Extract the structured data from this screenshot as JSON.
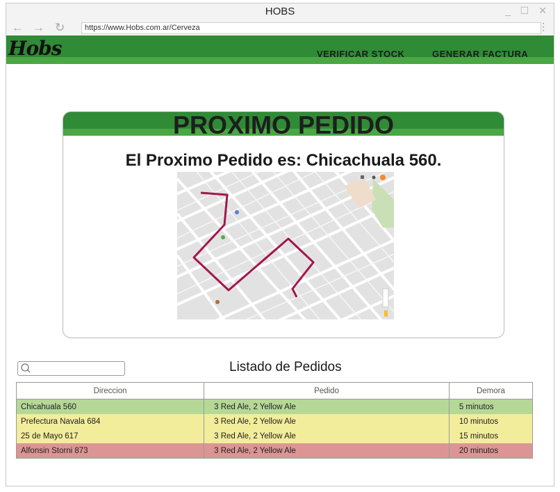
{
  "window": {
    "title": "HOBS",
    "minimize": "_",
    "maximize": "☐",
    "close": "✕"
  },
  "browser": {
    "url": "https://www.Hobs.com.ar/Cerveza",
    "back": "←",
    "forward": "→",
    "reload": "↻",
    "menu": "⋮"
  },
  "header": {
    "logo": "Hobs",
    "nav": [
      "VERIFICAR STOCK",
      "GENERAR FACTURA"
    ],
    "color_dark": "#2f8b35",
    "color_light": "#4aa744"
  },
  "next_order": {
    "title": "PROXIMO PEDIDO",
    "subtitle": "El Proximo Pedido es: Chicachuala 560.",
    "route_color": "#a3174a"
  },
  "search": {
    "placeholder": ""
  },
  "orders": {
    "title": "Listado de Pedidos",
    "columns": [
      "Direccion",
      "Pedido",
      "Demora"
    ],
    "rows": [
      {
        "direccion": "Chicahuala 560",
        "pedido": "3 Red Ale, 2 Yellow Ale",
        "demora": "5 minutos",
        "color": "#b5d897"
      },
      {
        "direccion": "Prefectura Navala 684",
        "pedido": "3 Red Ale, 2 Yellow Ale",
        "demora": "10 minutos",
        "color": "#f2ed9b"
      },
      {
        "direccion": "25 de Mayo 617",
        "pedido": "3 Red Ale, 2 Yellow Ale",
        "demora": "15 minutos",
        "color": "#f2ed9b"
      },
      {
        "direccion": "Alfonsin Storni 873",
        "pedido": "3 Red Ale, 2 Yellow Ale",
        "demora": "20 minutos",
        "color": "#dc9594"
      }
    ]
  }
}
